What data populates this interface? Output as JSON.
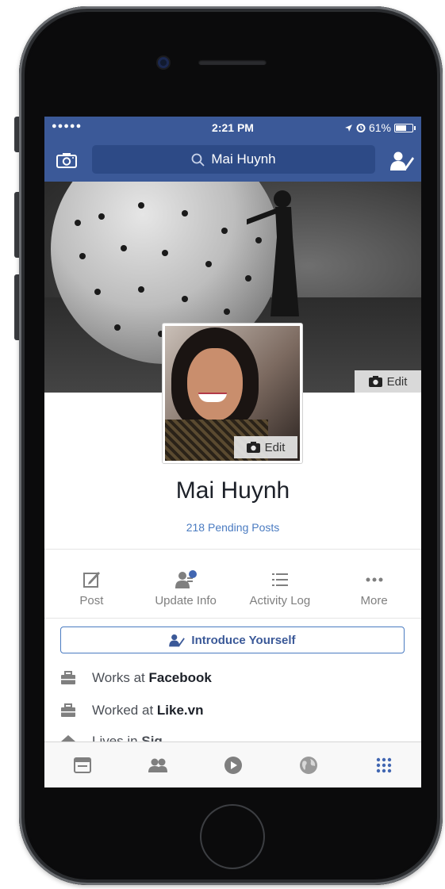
{
  "status_bar": {
    "signal": "●●●●●",
    "time": "2:21 PM",
    "battery": "61%",
    "battery_level": 0.61
  },
  "nav": {
    "search_text": "Mai Huynh",
    "left_icon": "camera-icon",
    "right_icon": "profile-edit-icon"
  },
  "profile": {
    "name": "Mai Huynh",
    "pending_posts": "218 Pending Posts",
    "cover_edit_label": "Edit",
    "avatar_edit_label": "Edit"
  },
  "actions": [
    {
      "label": "Post",
      "icon": "compose-icon"
    },
    {
      "label": "Update Info",
      "icon": "update-info-icon"
    },
    {
      "label": "Activity Log",
      "icon": "list-icon"
    },
    {
      "label": "More",
      "icon": "more-dots-icon"
    }
  ],
  "introduce": {
    "label": "Introduce Yourself"
  },
  "info": [
    {
      "prefix": "Works at ",
      "value": "Facebook",
      "icon": "briefcase-icon"
    },
    {
      "prefix": "Worked at ",
      "value": "Like.vn",
      "icon": "briefcase-icon"
    },
    {
      "prefix": "Lives in ",
      "value": "Sig",
      "icon": "home-icon"
    }
  ],
  "tabs": [
    {
      "icon": "news-feed-icon",
      "active": false
    },
    {
      "icon": "friends-icon",
      "active": false
    },
    {
      "icon": "video-icon",
      "active": false
    },
    {
      "icon": "notifications-globe-icon",
      "active": false
    },
    {
      "icon": "more-grid-icon",
      "active": true
    }
  ],
  "colors": {
    "brand": "#3b5998",
    "link": "#4a7bc1",
    "active_tab": "#4267b2",
    "inactive_icon": "#7f7f7f"
  }
}
